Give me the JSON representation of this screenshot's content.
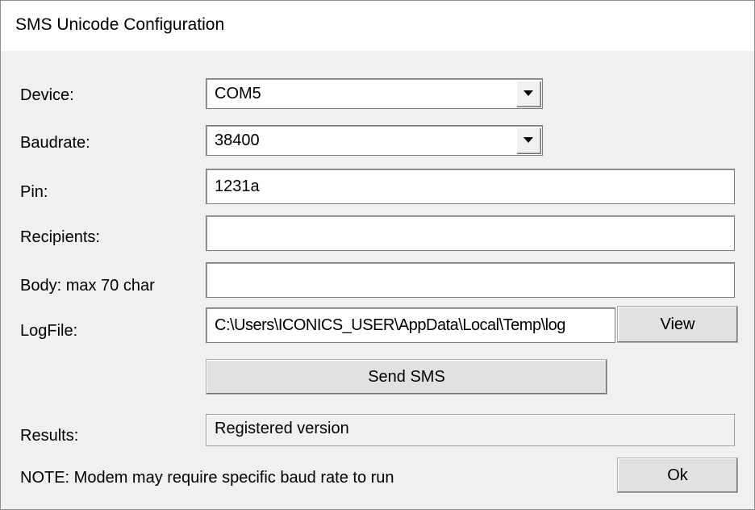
{
  "window": {
    "title": "SMS Unicode Configuration"
  },
  "form": {
    "device": {
      "label": "Device:",
      "value": "COM5"
    },
    "baudrate": {
      "label": "Baudrate:",
      "value": "38400"
    },
    "pin": {
      "label": "Pin:",
      "value": "1231a"
    },
    "recipients": {
      "label": "Recipients:",
      "value": ""
    },
    "body": {
      "label": "Body: max 70 char",
      "value": ""
    },
    "logfile": {
      "label": "LogFile:",
      "value": "C:\\Users\\ICONICS_USER\\AppData\\Local\\Temp\\log",
      "view_label": "View"
    },
    "send_label": "Send SMS",
    "results": {
      "label": "Results:",
      "value": "Registered version"
    },
    "note": "NOTE:  Modem may require specific baud rate to run",
    "ok_label": "Ok"
  },
  "icons": {
    "dropdown": "chevron-down-icon"
  }
}
